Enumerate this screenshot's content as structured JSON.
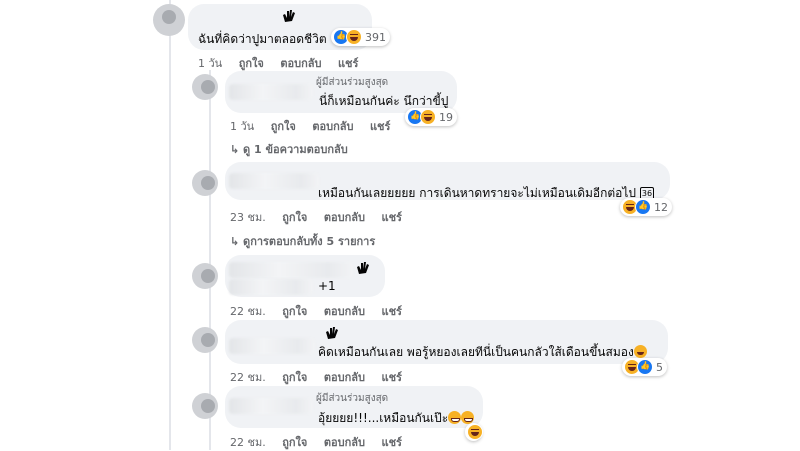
{
  "main_comment": {
    "text": "ฉันที่คิดว่าปูมาตลอดชีวิต",
    "reaction_count": "391",
    "time": "1 วัน",
    "like": "ถูกใจ",
    "reply": "ตอบกลับ",
    "share": "แชร์"
  },
  "replies": [
    {
      "badge": "ผู้มีส่วนร่วมสูงสุด",
      "text": "นี่ก็เหมือนกันค่ะ นึกว่าขี้ปู",
      "reaction_count": "19",
      "time": "1 วัน",
      "like": "ถูกใจ",
      "reply": "ตอบกลับ",
      "share": "แชร์",
      "view_replies": "ดู 1 ข้อความตอบกลับ"
    },
    {
      "text": "เหมือนกันเลยยยยย การเดินหาดทรายจะไม่เหมือนเดิมอีกต่อไป",
      "text_icon": "36",
      "reaction_count": "12",
      "time": "23 ชม.",
      "like": "ถูกใจ",
      "reply": "ตอบกลับ",
      "share": "แชร์",
      "view_replies": "ดูการตอบกลับทั้ง 5 รายการ"
    },
    {
      "text": "+1",
      "time": "22 ชม.",
      "like": "ถูกใจ",
      "reply": "ตอบกลับ",
      "share": "แชร์"
    },
    {
      "text": "คิดเหมือนกันเลย พอรู้หยองเลยทีนี่เป็นคนกลัวใส้เดือนขึ้นสมอง",
      "reaction_count": "5",
      "time": "22 ชม.",
      "like": "ถูกใจ",
      "reply": "ตอบกลับ",
      "share": "แชร์"
    },
    {
      "badge": "ผู้มีส่วนร่วมสูงสุด",
      "text": "อุ้ยยยย!!!...เหมือนกันเป๊ะ",
      "time": "22 ชม.",
      "like": "ถูกใจ",
      "reply": "ตอบกลับ",
      "share": "แชร์"
    }
  ],
  "colors": {
    "bubble": "#f0f2f5",
    "meta_text": "#65676b",
    "like_blue": "#1877f2",
    "haha_yellow": "#f7b125"
  },
  "icons": [
    "wave-hand-icon",
    "like-reaction-icon",
    "haha-reaction-icon",
    "reply-arrow-icon",
    "grin-emoji-icon"
  ]
}
